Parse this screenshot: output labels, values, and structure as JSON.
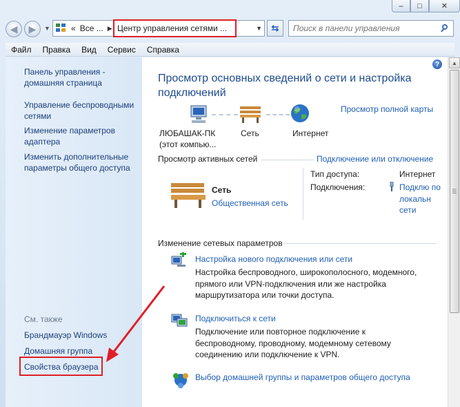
{
  "window": {
    "caption_buttons": [
      "–",
      "□",
      "✕"
    ]
  },
  "address_bar": {
    "back_icon": "back-arrow-icon",
    "forward_icon": "forward-arrow-icon",
    "prefix": "«",
    "segment_all": "Все ...",
    "current": "Центр управления сетями ...",
    "refresh_icon": "refresh-icon"
  },
  "search": {
    "placeholder": "Поиск в панели управления"
  },
  "menu": {
    "items": [
      "Файл",
      "Правка",
      "Вид",
      "Сервис",
      "Справка"
    ]
  },
  "sidebar": {
    "links": [
      "Панель управления - домашняя страница",
      "Управление беспроводными сетями",
      "Изменение параметров адаптера",
      "Изменить дополнительные параметры общего доступа"
    ],
    "see_also_title": "См. также",
    "see_also": [
      "Брандмауэр Windows",
      "Домашняя группа",
      "Свойства браузера"
    ]
  },
  "main": {
    "heading": "Просмотр основных сведений о сети и настройка подключений",
    "map_link": "Просмотр полной карты",
    "map": {
      "computer": "ЛЮБАШАК-ПК",
      "computer_sub": "(этот компью...",
      "network": "Сеть",
      "internet": "Интернет"
    },
    "active_title": "Просмотр активных сетей",
    "connect_link": "Подключение или отключение",
    "active_network": {
      "name": "Сеть",
      "type": "Общественная сеть",
      "access_label": "Тип доступа:",
      "access_value": "Интернет",
      "connections_label": "Подключения:",
      "connection_value": "Подклю по локальн сети"
    },
    "change_title": "Изменение сетевых параметров",
    "tasks": [
      {
        "title": "Настройка нового подключения или сети",
        "desc": "Настройка беспроводного, широкополосного, модемного, прямого или VPN-подключения или же настройка маршрутизатора или точки доступа."
      },
      {
        "title": "Подключиться к сети",
        "desc": "Подключение или повторное подключение к беспроводному, проводному, модемному сетевому соединению или подключение к VPN."
      },
      {
        "title": "Выбор домашней группы и параметров общего доступа",
        "desc": ""
      }
    ]
  },
  "colors": {
    "link": "#1f5fb5",
    "heading": "#1e4b8e",
    "highlight": "#e01f26",
    "sidebar_bg": "#dfeaf7"
  }
}
